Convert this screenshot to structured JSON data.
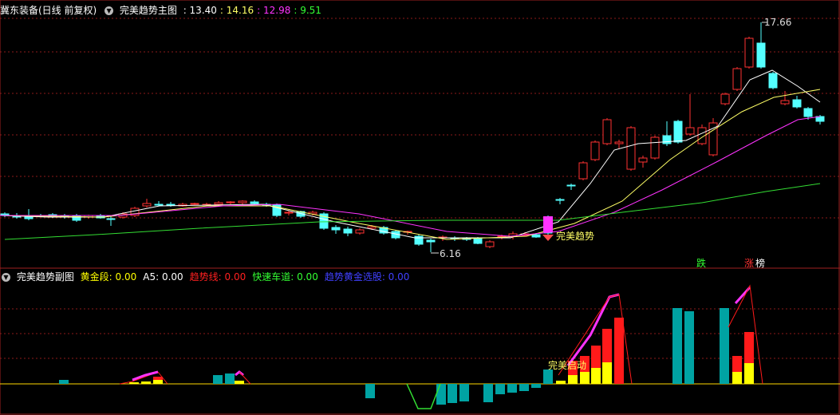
{
  "main_header": {
    "stock": "冀东装备(日线 前复权)",
    "indicator": "完美趋势主图",
    "values": [
      {
        "text": ": 13.40",
        "color": "#ffffff"
      },
      {
        "text": ": 14.16",
        "color": "#ffff66"
      },
      {
        "text": ": 12.98",
        "color": "#ff33ff"
      },
      {
        "text": ": 9.51",
        "color": "#33ff33"
      }
    ]
  },
  "main_annotations": {
    "high_label": "17.66",
    "low_label": "6.16",
    "signal_label": "完美趋势",
    "fall_label": "跌",
    "rise_label": "涨",
    "list_label": "榜"
  },
  "sub_header": {
    "indicator": "完美趋势副图",
    "items": [
      {
        "text": "黄金段: 0.00",
        "color": "#ffff00"
      },
      {
        "text": "A5: 0.00",
        "color": "#ffffff"
      },
      {
        "text": "趋势线: 0.00",
        "color": "#ff2020"
      },
      {
        "text": "快速车道: 0.00",
        "color": "#33ff33"
      },
      {
        "text": "趋势黄金选股: 0.00",
        "color": "#4040ff"
      }
    ]
  },
  "sub_annotations": {
    "start_label": "完美启动"
  },
  "colors": {
    "up": "#ff3232",
    "down": "#54ffff",
    "ma_fast": "#ffffff",
    "ma_mid": "#ffff66",
    "ma_slow": "#ff33ff",
    "ma_long": "#33dd33",
    "grid": "#8b1a1a"
  }
}
